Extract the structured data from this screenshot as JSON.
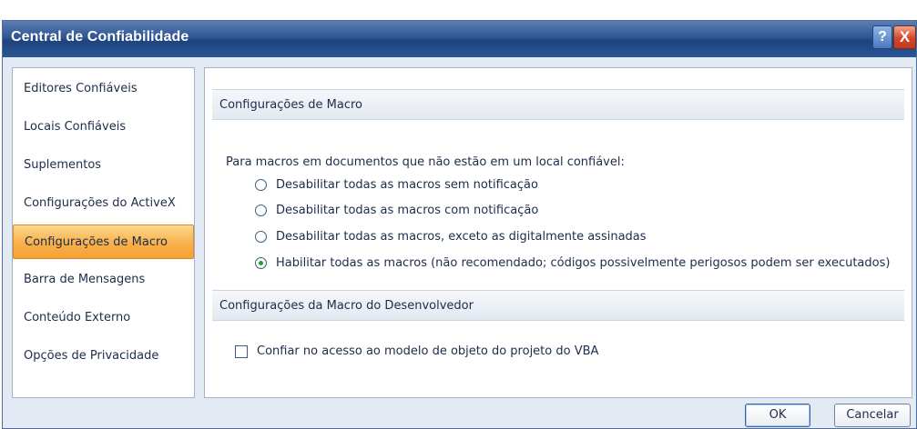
{
  "window": {
    "title": "Central de Confiabilidade",
    "help_glyph": "?",
    "close_glyph": "X"
  },
  "sidebar": {
    "items": [
      {
        "label": "Editores Confiáveis",
        "selected": false
      },
      {
        "label": "Locais Confiáveis",
        "selected": false
      },
      {
        "label": "Suplementos",
        "selected": false
      },
      {
        "label": "Configurações do ActiveX",
        "selected": false
      },
      {
        "label": "Configurações de Macro",
        "selected": true
      },
      {
        "label": "Barra de Mensagens",
        "selected": false
      },
      {
        "label": "Conteúdo Externo",
        "selected": false
      },
      {
        "label": "Opções de Privacidade",
        "selected": false
      }
    ]
  },
  "macro_settings": {
    "header": "Configurações de Macro",
    "description": "Para macros em documentos que não estão em um local confiável:",
    "options": [
      {
        "label": "Desabilitar todas as macros sem notificação",
        "checked": false
      },
      {
        "label": "Desabilitar todas as macros com notificação",
        "checked": false
      },
      {
        "label": "Desabilitar todas as macros, exceto as digitalmente assinadas",
        "checked": false
      },
      {
        "label": "Habilitar todas as macros (não recomendado; códigos possivelmente perigosos podem ser executados)",
        "checked": true
      }
    ]
  },
  "developer_settings": {
    "header": "Configurações da Macro do Desenvolvedor",
    "vba_trust_label": "Confiar no acesso ao modelo de objeto do projeto do VBA",
    "vba_trust_checked": false
  },
  "buttons": {
    "ok_label": "OK",
    "cancel_label": "Cancelar"
  },
  "colors": {
    "title_bar": "#2f5694",
    "selected_item": "#f8b04c",
    "radio_checked": "#2e9a2e"
  }
}
